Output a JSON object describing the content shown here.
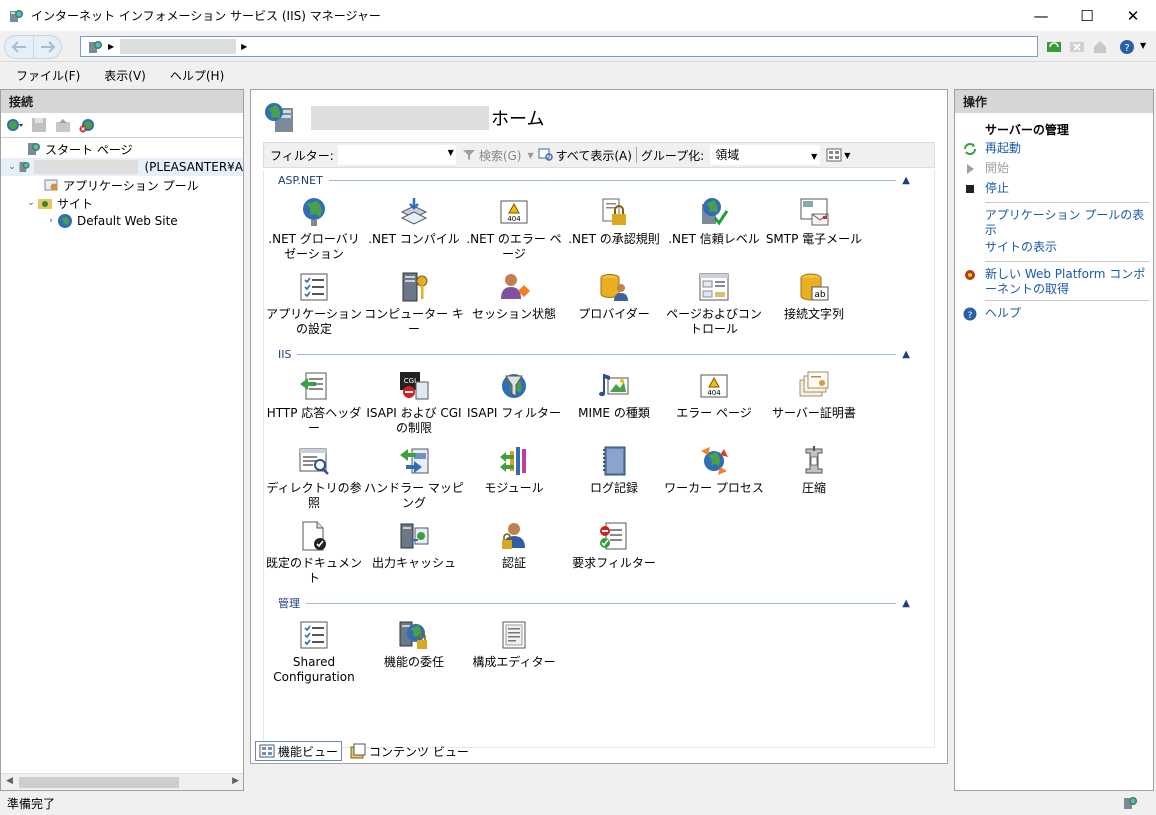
{
  "window": {
    "title": "インターネット インフォメーション サービス (IIS) マネージャー",
    "minimize": "—",
    "maximize": "☐",
    "close": "✕"
  },
  "addressbar": {
    "back_icon": "back-arrow-icon",
    "forward_icon": "forward-arrow-icon"
  },
  "menu": {
    "items": [
      "ファイル(F)",
      "表示(V)",
      "ヘルプ(H)"
    ]
  },
  "connections": {
    "title": "接続",
    "tree": [
      {
        "label": "スタート ページ",
        "icon": "start-page-icon"
      },
      {
        "label": "(PLEASANTER¥A",
        "icon": "server-icon"
      },
      {
        "label": "アプリケーション プール",
        "icon": "app-pool-icon"
      },
      {
        "label": "サイト",
        "icon": "sites-folder-icon"
      },
      {
        "label": "Default Web Site",
        "icon": "globe-icon"
      }
    ]
  },
  "center": {
    "page_title": "ホーム",
    "filter": {
      "label": "フィルター:",
      "search": "検索(G)",
      "show_all": "すべて表示(A)",
      "group_by_label": "グループ化:",
      "group_by_value": "領域"
    },
    "groups": [
      {
        "title": "ASP.NET",
        "features": [
          ".NET グローバリゼーション",
          ".NET コンパイル",
          ".NET のエラー ページ",
          ".NET の承認規則",
          ".NET 信頼レベル",
          "SMTP 電子メール",
          "アプリケーションの設定",
          "コンピューター キー",
          "セッション状態",
          "プロバイダー",
          "ページおよびコントロール",
          "接続文字列"
        ]
      },
      {
        "title": "IIS",
        "features": [
          "HTTP 応答ヘッダー",
          "ISAPI および CGI の制限",
          "ISAPI フィルター",
          "MIME の種類",
          "エラー ページ",
          "サーバー証明書",
          "ディレクトリの参照",
          "ハンドラー マッピング",
          "モジュール",
          "ログ記録",
          "ワーカー プロセス",
          "圧縮",
          "既定のドキュメント",
          "出力キャッシュ",
          "認証",
          "要求フィルター"
        ]
      },
      {
        "title": "管理",
        "features": [
          "Shared Configuration",
          "機能の委任",
          "構成エディター"
        ]
      }
    ],
    "view_tabs": [
      "機能ビュー",
      "コンテンツ ビュー"
    ]
  },
  "actions": {
    "title": "操作",
    "heading": "サーバーの管理",
    "items": [
      {
        "label": "再起動",
        "icon": "restart-icon",
        "enabled": true
      },
      {
        "label": "開始",
        "icon": "start-icon",
        "enabled": false
      },
      {
        "label": "停止",
        "icon": "stop-icon",
        "enabled": true
      },
      {
        "label": "アプリケーション プールの表示",
        "icon": "",
        "enabled": true
      },
      {
        "label": "サイトの表示",
        "icon": "",
        "enabled": true
      },
      {
        "label": "新しい Web Platform コンポーネントの取得",
        "icon": "web-platform-icon",
        "enabled": true
      },
      {
        "label": "ヘルプ",
        "icon": "help-icon",
        "enabled": true
      }
    ]
  },
  "status": {
    "text": "準備完了"
  },
  "colors": {
    "link": "#1a5aa6",
    "group_title": "#1f3d7a",
    "panel_header": "#d6d6d6"
  }
}
